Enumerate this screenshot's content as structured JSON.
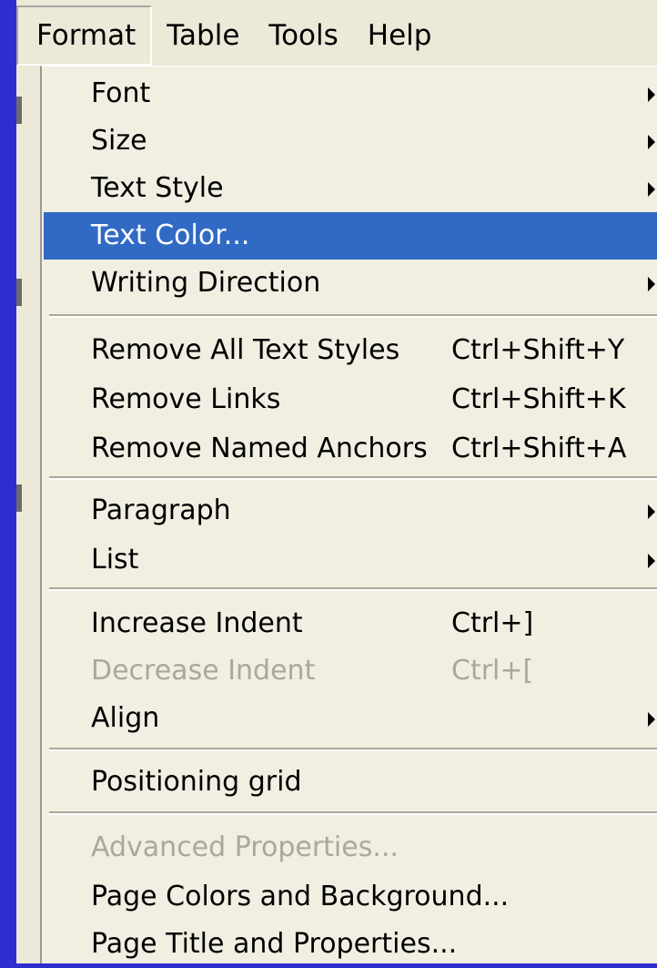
{
  "menubar": {
    "items": [
      "Format",
      "Table",
      "Tools",
      "Help"
    ],
    "active": "Format"
  },
  "format_menu": {
    "font": {
      "label": "Font"
    },
    "size": {
      "label": "Size"
    },
    "text_style": {
      "label": "Text Style"
    },
    "text_color": {
      "label": "Text Color...",
      "highlighted": true
    },
    "writing_direction": {
      "label": "Writing Direction"
    },
    "remove_all_text_styles": {
      "label": "Remove All Text Styles",
      "shortcut": "Ctrl+Shift+Y"
    },
    "remove_links": {
      "label": "Remove Links",
      "shortcut": "Ctrl+Shift+K"
    },
    "remove_named_anchors": {
      "label": "Remove Named Anchors",
      "shortcut": "Ctrl+Shift+A"
    },
    "paragraph": {
      "label": "Paragraph"
    },
    "list": {
      "label": "List"
    },
    "increase_indent": {
      "label": "Increase Indent",
      "shortcut": "Ctrl+]"
    },
    "decrease_indent": {
      "label": "Decrease Indent",
      "shortcut": "Ctrl+[",
      "disabled": true
    },
    "align": {
      "label": "Align"
    },
    "positioning_grid": {
      "label": "Positioning grid"
    },
    "advanced_properties": {
      "label": "Advanced Properties...",
      "disabled": true
    },
    "page_colors": {
      "label": "Page Colors and Background..."
    },
    "page_title": {
      "label": "Page Title and Properties..."
    }
  },
  "colors": {
    "desktop_background": "#2e2ecf",
    "menu_background": "#f1efe2",
    "highlight": "#316ac5",
    "disabled_text": "#aca899"
  },
  "icons": {
    "submenu": "chevron-right-icon"
  }
}
